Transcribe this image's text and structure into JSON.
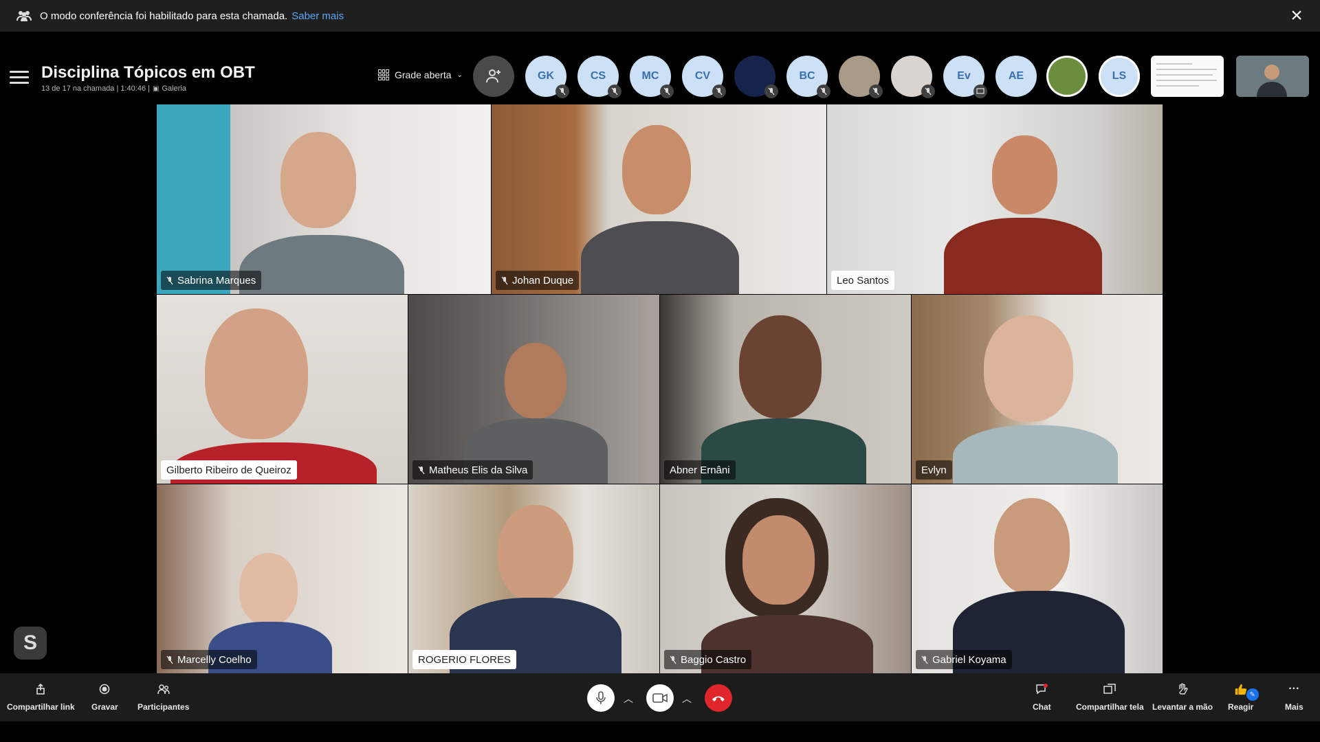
{
  "banner": {
    "text": "O modo conferência foi habilitado para esta chamada.",
    "link": "Saber mais",
    "icon": "people-icon",
    "close_icon": "close-icon"
  },
  "header": {
    "title": "Disciplina Tópicos em OBT",
    "status": "13 de 17 na chamada | 1:40:46 |",
    "view_mode": "Galeria",
    "layout_label": "Grade aberta"
  },
  "participants_bar": [
    {
      "initials": "GK",
      "muted": true
    },
    {
      "initials": "CS",
      "muted": true
    },
    {
      "initials": "MC",
      "muted": true
    },
    {
      "initials": "CV",
      "muted": true
    },
    {
      "initials": "",
      "muted": true
    },
    {
      "initials": "BC",
      "muted": true
    },
    {
      "initials": "",
      "muted": true
    },
    {
      "initials": "",
      "muted": true
    },
    {
      "initials": "Ev",
      "muted": false
    },
    {
      "initials": "AE",
      "muted": false
    },
    {
      "initials": "",
      "muted": false
    },
    {
      "initials": "LS",
      "muted": false
    }
  ],
  "videos": [
    {
      "name": "Sabrina Marques",
      "muted": true
    },
    {
      "name": "Johan Duque",
      "muted": true
    },
    {
      "name": "Leo Santos",
      "muted": false
    },
    {
      "name": "Gilberto Ribeiro de Queiroz",
      "muted": false
    },
    {
      "name": "Matheus Elis da Silva",
      "muted": true
    },
    {
      "name": "Abner Ernâni",
      "muted": false
    },
    {
      "name": "Evlyn",
      "muted": false
    },
    {
      "name": "Marcelly Coelho",
      "muted": true
    },
    {
      "name": "ROGERIO FLORES",
      "muted": false
    },
    {
      "name": "Baggio Castro",
      "muted": true
    },
    {
      "name": "Gabriel Koyama",
      "muted": true
    }
  ],
  "skype_logo": "S",
  "toolbar": {
    "share_link": "Compartilhar link",
    "record": "Gravar",
    "participants": "Participantes",
    "chat": "Chat",
    "share_screen": "Compartilhar tela",
    "raise_hand": "Levantar a mão",
    "react": "Reagir",
    "more": "Mais"
  },
  "colors": {
    "end_call": "#e0262b",
    "accent_link": "#5ba6f5"
  }
}
